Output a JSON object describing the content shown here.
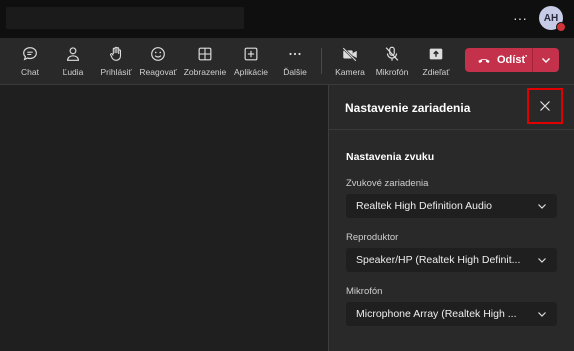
{
  "topbar": {
    "more_label": "···",
    "avatar_initials": "AH",
    "presence_color": "#d13438"
  },
  "toolbar": {
    "chat": "Chat",
    "people": "Ľudia",
    "raise": "Prihlásiť",
    "react": "Reagovať",
    "view": "Zobrazenie",
    "apps": "Aplikácie",
    "more": "Ďalšie",
    "camera": "Kamera",
    "mic": "Mikrofón",
    "share": "Zdieľať",
    "leave": "Odísť"
  },
  "panel": {
    "title": "Nastavenie zariadenia",
    "section": "Nastavenia zvuku",
    "fields": [
      {
        "label": "Zvukové zariadenia",
        "value": "Realtek High Definition Audio"
      },
      {
        "label": "Reproduktor",
        "value": "Speaker/HP (Realtek High Definit..."
      },
      {
        "label": "Mikrofón",
        "value": "Microphone Array (Realtek High ..."
      }
    ]
  },
  "colors": {
    "accent_leave": "#c4314b",
    "highlight": "#e00000",
    "background": "#1f1f1f",
    "panel": "#292929"
  }
}
